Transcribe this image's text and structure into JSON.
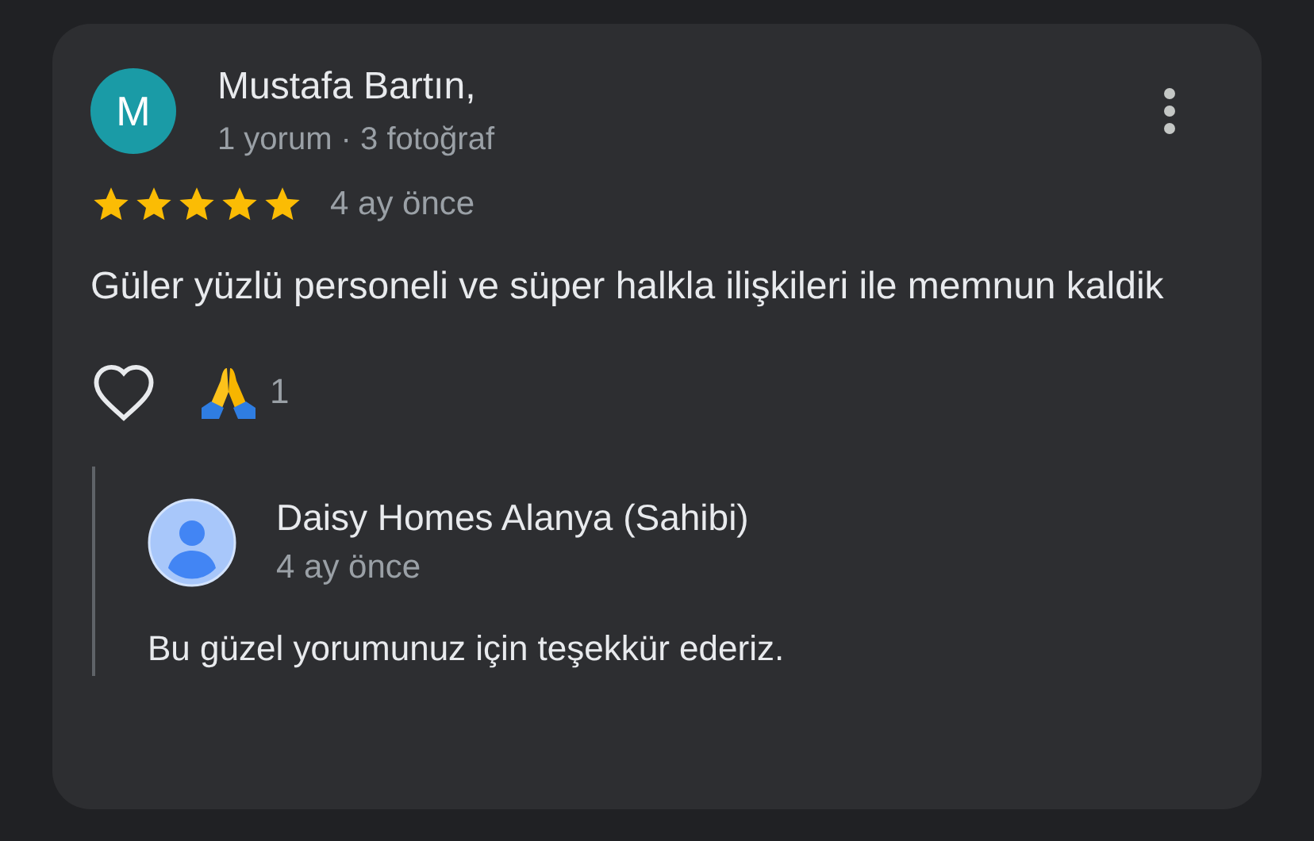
{
  "review": {
    "avatar_letter": "M",
    "author": "Mustafa Bartın,",
    "meta": "1 yorum · 3 fotoğraf",
    "stars": 5,
    "time": "4 ay önce",
    "text": "Güler yüzlü personeli ve süper halkla ilişkileri ile memnun kaldik",
    "liked": false,
    "reaction_count": "1"
  },
  "reply": {
    "author": "Daisy Homes Alanya (Sahibi)",
    "time": "4 ay önce",
    "text": "Bu güzel yorumunuz için teşekkür ederiz."
  }
}
